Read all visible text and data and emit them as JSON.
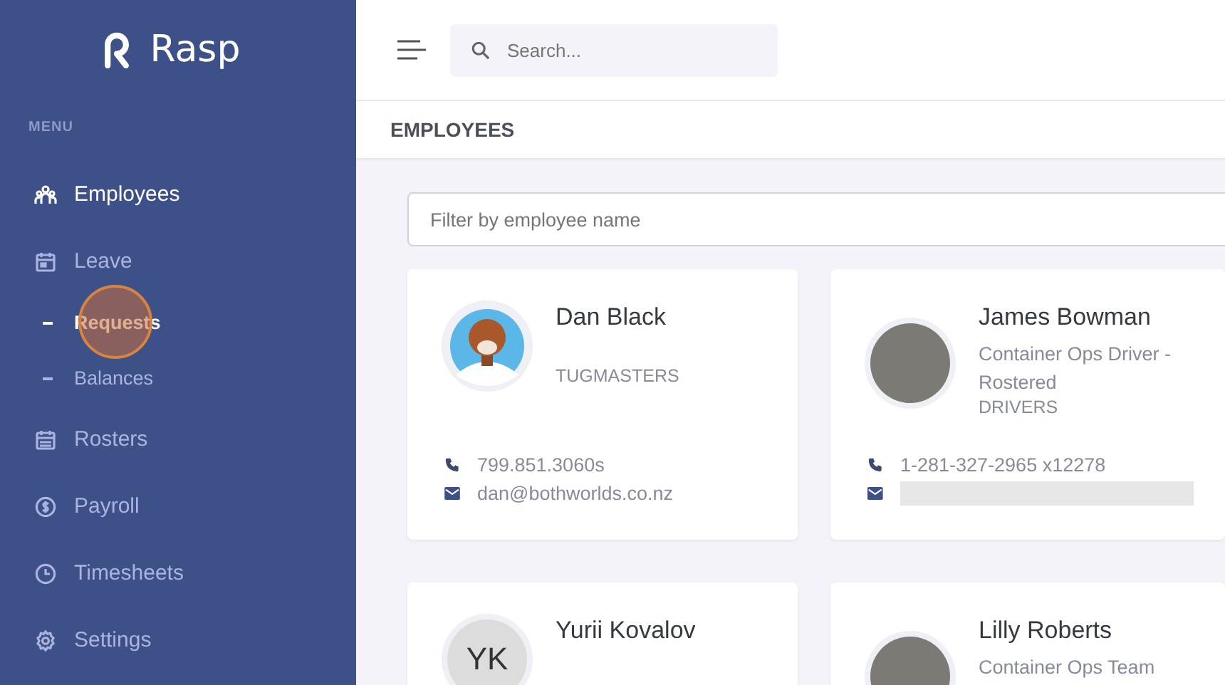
{
  "brand": {
    "name": "Rasp"
  },
  "sidebar": {
    "heading": "MENU",
    "items": [
      {
        "label": "Employees",
        "selected": true
      },
      {
        "label": "Leave",
        "selected": false,
        "children": [
          {
            "label": "Requests",
            "selected": true,
            "clicked": true
          },
          {
            "label": "Balances",
            "selected": false,
            "clicked": false
          }
        ]
      },
      {
        "label": "Rosters",
        "selected": false
      },
      {
        "label": "Payroll",
        "selected": false
      },
      {
        "label": "Timesheets",
        "selected": false
      },
      {
        "label": "Settings",
        "selected": false
      }
    ]
  },
  "search": {
    "placeholder": "Search..."
  },
  "page_title": "EMPLOYEES",
  "filter": {
    "placeholder": "Filter by employee name"
  },
  "employees": [
    {
      "name": "Dan Black",
      "kind": "illustration",
      "team": "TUGMASTERS",
      "phone": "799.851.3060s",
      "email": "dan@bothworlds.co.nz",
      "email_redacted": false
    },
    {
      "name": "James Bowman",
      "kind": "photo",
      "role": "Container Ops Driver - Rostered",
      "team": "DRIVERS",
      "phone": "1-281-327-2965 x12278",
      "email_redacted": true
    },
    {
      "name": "Yurii Kovalov",
      "kind": "initials",
      "initials": "YK"
    },
    {
      "name": "Lilly Roberts",
      "kind": "photo",
      "role": "Container Ops Team"
    }
  ]
}
